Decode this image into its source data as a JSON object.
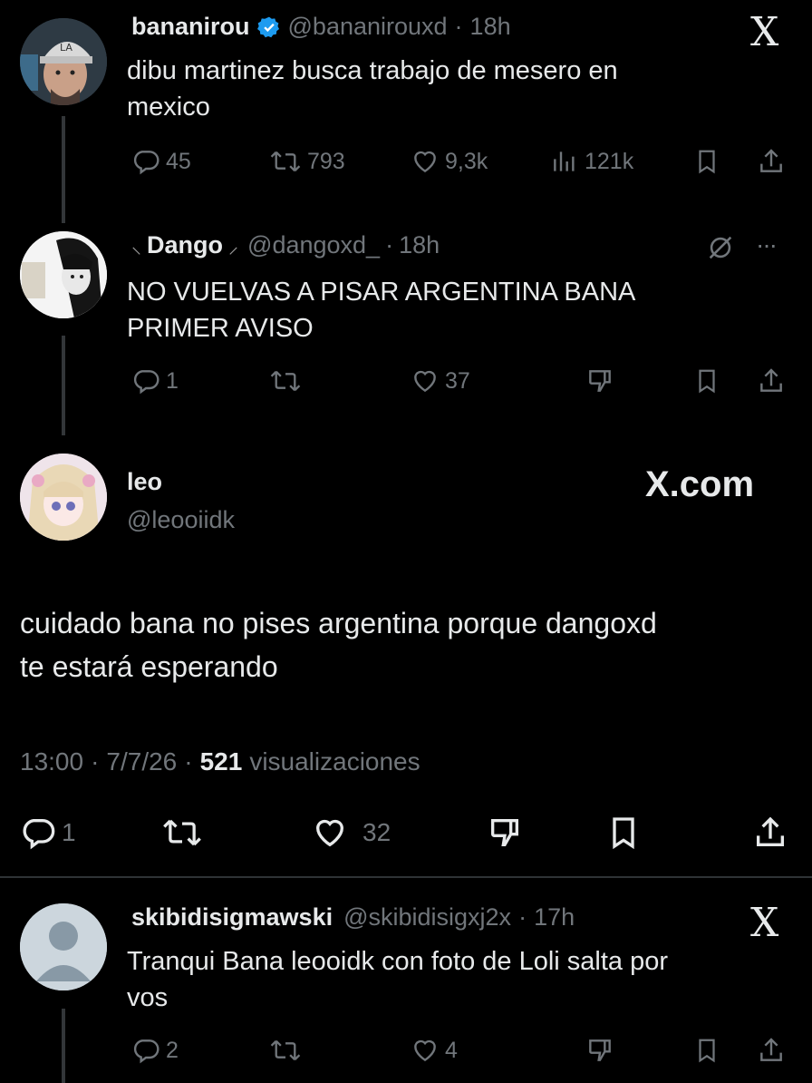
{
  "tweet1": {
    "name": "bananirou",
    "handle": "@bananirouxd",
    "time": "18h",
    "text_line1": "dibu martinez busca trabajo de mesero en",
    "text_line2": "mexico",
    "replies": "45",
    "retweets": "793",
    "likes": "9,3k",
    "views": "121k",
    "logo": "X",
    "avatar_cap_text": "LA"
  },
  "tweet2": {
    "name": "Dango",
    "handle": "@dangoxd_",
    "time": "18h",
    "text_line1": "NO VUELVAS A PISAR ARGENTINA BANA",
    "text_line2": "PRIMER AVISO",
    "replies": "1",
    "likes": "37",
    "more": "···"
  },
  "main": {
    "name": "leo",
    "handle": "@leooiidk",
    "brand": "X.com",
    "text_line1": "cuidado bana no pises argentina porque dangoxd",
    "text_line2": "te estará esperando",
    "time": "13:00",
    "date": "7/7/26",
    "views_count": "521",
    "views_label": "visualizaciones",
    "replies": "1",
    "likes": "32"
  },
  "tweet3": {
    "name": "skibidisigmawski",
    "handle": "@skibidisigxj2x",
    "time": "17h",
    "text_line1": "Tranqui Bana leooidk con foto de Loli salta por",
    "text_line2": "vos",
    "replies": "2",
    "likes": "4",
    "logo": "X"
  },
  "separator": "·",
  "colors": {
    "background": "#000000",
    "text": "#e7e9ea",
    "muted": "#71767b",
    "verified": "#1d9bf0",
    "divider": "#2f3336"
  }
}
